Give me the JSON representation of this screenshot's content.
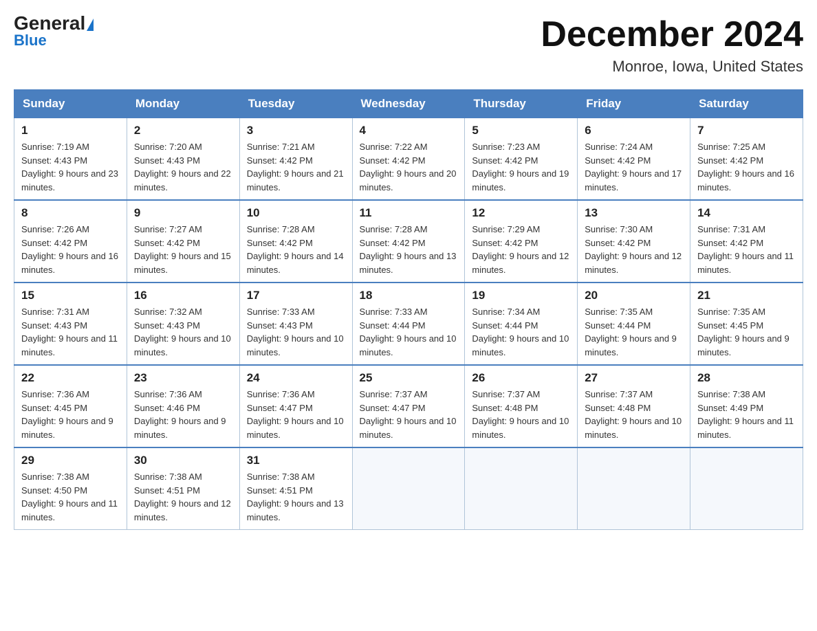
{
  "header": {
    "logo_main": "General",
    "logo_sub": "Blue",
    "title": "December 2024",
    "subtitle": "Monroe, Iowa, United States"
  },
  "days_of_week": [
    "Sunday",
    "Monday",
    "Tuesday",
    "Wednesday",
    "Thursday",
    "Friday",
    "Saturday"
  ],
  "weeks": [
    [
      {
        "day": "1",
        "sunrise": "7:19 AM",
        "sunset": "4:43 PM",
        "daylight": "9 hours and 23 minutes."
      },
      {
        "day": "2",
        "sunrise": "7:20 AM",
        "sunset": "4:43 PM",
        "daylight": "9 hours and 22 minutes."
      },
      {
        "day": "3",
        "sunrise": "7:21 AM",
        "sunset": "4:42 PM",
        "daylight": "9 hours and 21 minutes."
      },
      {
        "day": "4",
        "sunrise": "7:22 AM",
        "sunset": "4:42 PM",
        "daylight": "9 hours and 20 minutes."
      },
      {
        "day": "5",
        "sunrise": "7:23 AM",
        "sunset": "4:42 PM",
        "daylight": "9 hours and 19 minutes."
      },
      {
        "day": "6",
        "sunrise": "7:24 AM",
        "sunset": "4:42 PM",
        "daylight": "9 hours and 17 minutes."
      },
      {
        "day": "7",
        "sunrise": "7:25 AM",
        "sunset": "4:42 PM",
        "daylight": "9 hours and 16 minutes."
      }
    ],
    [
      {
        "day": "8",
        "sunrise": "7:26 AM",
        "sunset": "4:42 PM",
        "daylight": "9 hours and 16 minutes."
      },
      {
        "day": "9",
        "sunrise": "7:27 AM",
        "sunset": "4:42 PM",
        "daylight": "9 hours and 15 minutes."
      },
      {
        "day": "10",
        "sunrise": "7:28 AM",
        "sunset": "4:42 PM",
        "daylight": "9 hours and 14 minutes."
      },
      {
        "day": "11",
        "sunrise": "7:28 AM",
        "sunset": "4:42 PM",
        "daylight": "9 hours and 13 minutes."
      },
      {
        "day": "12",
        "sunrise": "7:29 AM",
        "sunset": "4:42 PM",
        "daylight": "9 hours and 12 minutes."
      },
      {
        "day": "13",
        "sunrise": "7:30 AM",
        "sunset": "4:42 PM",
        "daylight": "9 hours and 12 minutes."
      },
      {
        "day": "14",
        "sunrise": "7:31 AM",
        "sunset": "4:42 PM",
        "daylight": "9 hours and 11 minutes."
      }
    ],
    [
      {
        "day": "15",
        "sunrise": "7:31 AM",
        "sunset": "4:43 PM",
        "daylight": "9 hours and 11 minutes."
      },
      {
        "day": "16",
        "sunrise": "7:32 AM",
        "sunset": "4:43 PM",
        "daylight": "9 hours and 10 minutes."
      },
      {
        "day": "17",
        "sunrise": "7:33 AM",
        "sunset": "4:43 PM",
        "daylight": "9 hours and 10 minutes."
      },
      {
        "day": "18",
        "sunrise": "7:33 AM",
        "sunset": "4:44 PM",
        "daylight": "9 hours and 10 minutes."
      },
      {
        "day": "19",
        "sunrise": "7:34 AM",
        "sunset": "4:44 PM",
        "daylight": "9 hours and 10 minutes."
      },
      {
        "day": "20",
        "sunrise": "7:35 AM",
        "sunset": "4:44 PM",
        "daylight": "9 hours and 9 minutes."
      },
      {
        "day": "21",
        "sunrise": "7:35 AM",
        "sunset": "4:45 PM",
        "daylight": "9 hours and 9 minutes."
      }
    ],
    [
      {
        "day": "22",
        "sunrise": "7:36 AM",
        "sunset": "4:45 PM",
        "daylight": "9 hours and 9 minutes."
      },
      {
        "day": "23",
        "sunrise": "7:36 AM",
        "sunset": "4:46 PM",
        "daylight": "9 hours and 9 minutes."
      },
      {
        "day": "24",
        "sunrise": "7:36 AM",
        "sunset": "4:47 PM",
        "daylight": "9 hours and 10 minutes."
      },
      {
        "day": "25",
        "sunrise": "7:37 AM",
        "sunset": "4:47 PM",
        "daylight": "9 hours and 10 minutes."
      },
      {
        "day": "26",
        "sunrise": "7:37 AM",
        "sunset": "4:48 PM",
        "daylight": "9 hours and 10 minutes."
      },
      {
        "day": "27",
        "sunrise": "7:37 AM",
        "sunset": "4:48 PM",
        "daylight": "9 hours and 10 minutes."
      },
      {
        "day": "28",
        "sunrise": "7:38 AM",
        "sunset": "4:49 PM",
        "daylight": "9 hours and 11 minutes."
      }
    ],
    [
      {
        "day": "29",
        "sunrise": "7:38 AM",
        "sunset": "4:50 PM",
        "daylight": "9 hours and 11 minutes."
      },
      {
        "day": "30",
        "sunrise": "7:38 AM",
        "sunset": "4:51 PM",
        "daylight": "9 hours and 12 minutes."
      },
      {
        "day": "31",
        "sunrise": "7:38 AM",
        "sunset": "4:51 PM",
        "daylight": "9 hours and 13 minutes."
      },
      null,
      null,
      null,
      null
    ]
  ]
}
